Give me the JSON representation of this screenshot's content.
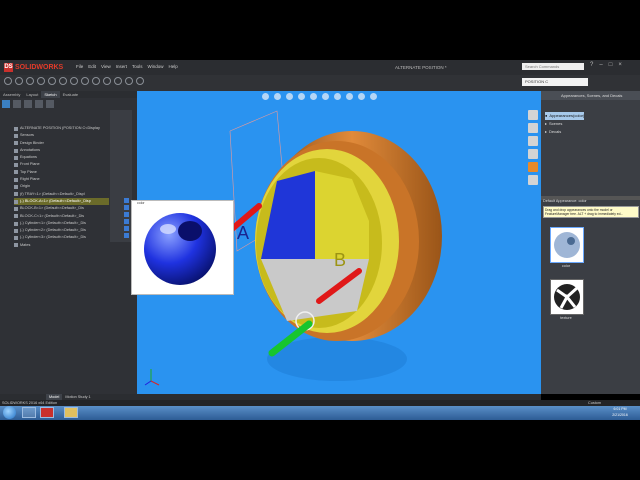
{
  "app": {
    "brand": "SOLIDWORKS",
    "title": "ALTERNATE POSITION *"
  },
  "menu": [
    "File",
    "Edit",
    "View",
    "Insert",
    "Tools",
    "Window",
    "Help"
  ],
  "search": {
    "placeholder": "Search Commands"
  },
  "window_controls": [
    "?",
    "–",
    "□",
    "×"
  ],
  "configuration": {
    "selected": "POSITION C"
  },
  "command_tabs": [
    "Assembly",
    "Layout",
    "Sketch",
    "Evaluate"
  ],
  "feature_tree": [
    {
      "label": "ALTERNATE POSITION (POSITION C<Display",
      "state": "normal"
    },
    {
      "label": "Sensors",
      "state": "normal"
    },
    {
      "label": "Design Binder",
      "state": "normal"
    },
    {
      "label": "Annotations",
      "state": "normal"
    },
    {
      "label": "Equations",
      "state": "normal"
    },
    {
      "label": "Front Plane",
      "state": "normal"
    },
    {
      "label": "Top Plane",
      "state": "normal"
    },
    {
      "label": "Right Plane",
      "state": "normal"
    },
    {
      "label": "Origin",
      "state": "normal"
    },
    {
      "label": "(f) TRAY<1> (Default<<Default>_Displ",
      "state": "normal"
    },
    {
      "label": "(-) BLOCK-A<1> (Default<<Default>_Disp",
      "state": "hl"
    },
    {
      "label": "BLOCK-B<1> (Default<<Default>_Dis",
      "state": "normal"
    },
    {
      "label": "BLOCK-C<1> (Default<<Default>_Dis",
      "state": "normal"
    },
    {
      "label": "(-) Cylinder<1> (Default<<Default>_Dis",
      "state": "normal"
    },
    {
      "label": "(-) Cylinder<2> (Default<<Default>_Dis",
      "state": "normal"
    },
    {
      "label": "(-) Cylinder<3> (Default<<Default>_Dis",
      "state": "normal"
    },
    {
      "label": "Mates",
      "state": "normal"
    }
  ],
  "preview": {
    "label": "color"
  },
  "task_pane": {
    "title": "Appearances, Scenes, and Decals",
    "tree": [
      {
        "label": "Appearances(color)",
        "selected": true
      },
      {
        "label": "Scenes",
        "selected": false
      },
      {
        "label": "Decals",
        "selected": false
      }
    ],
    "section_label": "Default Appearance: color",
    "tooltip": "Drag and drop appearances onto the model or FeatureManager tree. ALT + drag to immediately ed...",
    "swatches": [
      {
        "label": "color"
      },
      {
        "label": "texture"
      }
    ]
  },
  "bottom_tabs": [
    "Model",
    "Motion Study 1"
  ],
  "status": {
    "text": "SOLIDWORKS 2016 x64 Edition",
    "units": "Custom"
  },
  "clock": {
    "time": "6:01 PM",
    "date": "2/21/2016"
  },
  "colors": {
    "viewport": "#2a93f0",
    "accent": "#3b80c2"
  }
}
